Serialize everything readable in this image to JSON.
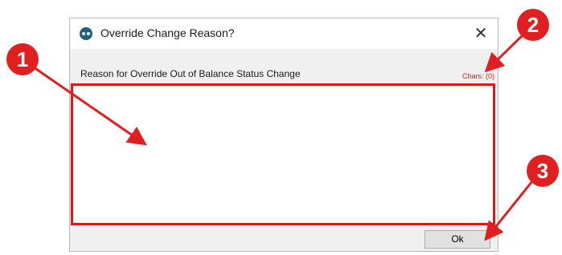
{
  "dialog": {
    "title": "Override Change Reason?",
    "close_label": "✕",
    "prompt_label": "Reason for Override Out of Balance Status Change",
    "chars_counter": "Chars: (0)",
    "reason_value": "",
    "ok_label": "Ok"
  },
  "annotations": {
    "badge_1": "1",
    "badge_2": "2",
    "badge_3": "3"
  },
  "colors": {
    "annotation": "#e02020",
    "dialog_bg": "#f0f0f0",
    "app_icon": "#1e5f7e"
  }
}
